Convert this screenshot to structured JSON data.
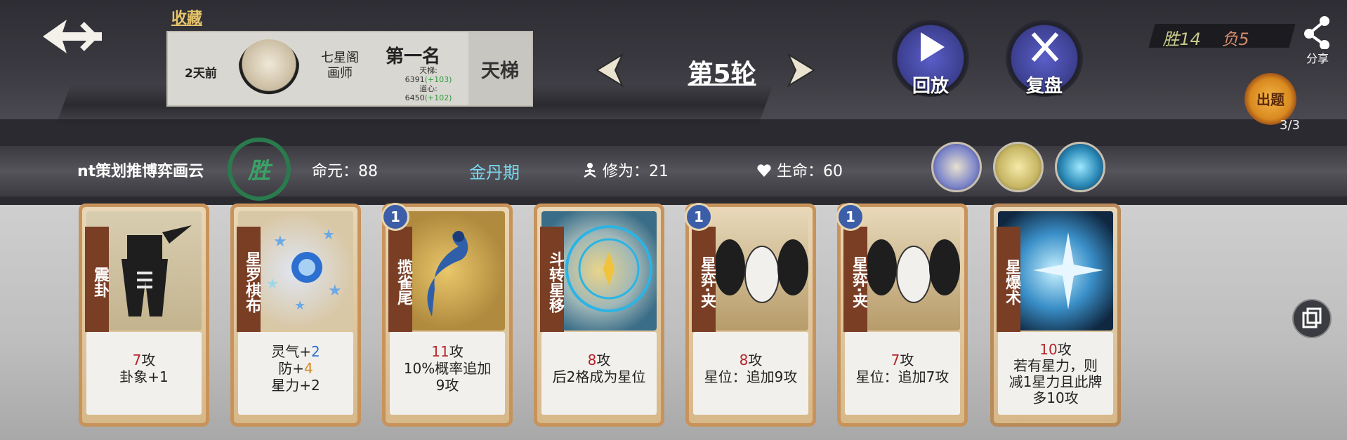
{
  "header": {
    "favorite_label": "收藏",
    "record": {
      "time": "2天前",
      "rank_title_line1": "七星阁",
      "rank_title_line2": "画师",
      "placement": "第一名",
      "ladder_label": "天梯:",
      "ladder_value": "6391",
      "ladder_gain": "(+103)",
      "heart_label": "道心:",
      "heart_value": "6450",
      "heart_gain": "(+102)",
      "mode": "天梯"
    },
    "round_label": "第5轮",
    "replay_label": "回放",
    "review_label": "复盘",
    "score_win": "胜14",
    "score_loss": "负5",
    "share_label": "分享",
    "puzzle_label": "出题",
    "puzzle_count": "3/3"
  },
  "player": {
    "name": "nt策划推博弈画云",
    "result": "胜",
    "life_label": "命元：",
    "life_value": "88",
    "realm": "金丹期",
    "cultivation_label": "修为：",
    "cultivation_value": "21",
    "hp_label": "生命：",
    "hp_value": "60"
  },
  "cards": [
    {
      "name": "震卦",
      "cost": "",
      "atk": "7",
      "atk_suffix": "攻",
      "line2": "卦象+1",
      "line3": ""
    },
    {
      "name": "星罗棋布",
      "cost": "",
      "l1_pre": "灵气+",
      "l1_val": "2",
      "l2_pre": "防+",
      "l2_val": "4",
      "l3": "星力+2"
    },
    {
      "name": "揽雀尾",
      "cost": "1",
      "atk": "11",
      "atk_suffix": "攻",
      "line2": "10%概率追加",
      "line3": "9攻"
    },
    {
      "name": "斗转星移",
      "cost": "",
      "atk": "8",
      "atk_suffix": "攻",
      "line2": "后2格成为星位",
      "line3": ""
    },
    {
      "name": "星弈·夹",
      "cost": "1",
      "atk": "8",
      "atk_suffix": "攻",
      "line2": "星位：追加9攻",
      "line3": ""
    },
    {
      "name": "星弈·夹",
      "cost": "1",
      "atk": "7",
      "atk_suffix": "攻",
      "line2": "星位：追加7攻",
      "line3": ""
    },
    {
      "name": "星爆术",
      "cost": "",
      "atk": "10",
      "atk_suffix": "攻",
      "line2": "若有星力，则",
      "line3": "减1星力且此牌",
      "line4": "多10攻"
    }
  ],
  "colors": {
    "accent_gold": "#e6c46a",
    "win_green": "#3aa366",
    "realm_cyan": "#7ad8f0",
    "attack_red": "#b3242a"
  },
  "icons": [
    "back-arrow-icon",
    "play-icon",
    "crossed-swords-icon",
    "share-icon",
    "lantern-icon",
    "meditation-icon",
    "heart-icon",
    "copy-icon"
  ]
}
